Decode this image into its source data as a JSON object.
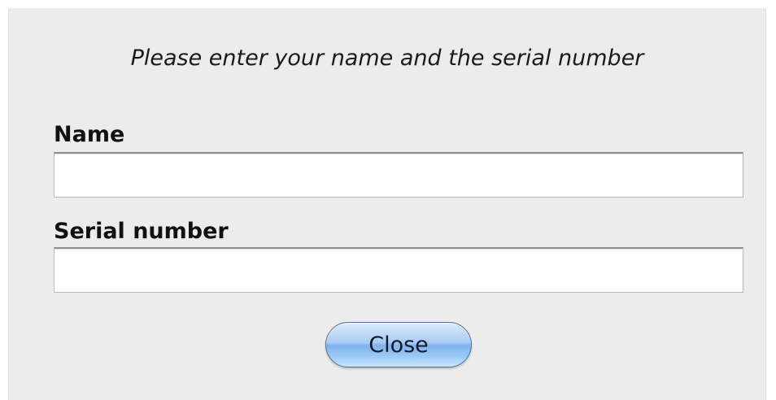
{
  "dialog": {
    "prompt": "Please enter your name and the serial number",
    "fields": {
      "name": {
        "label": "Name",
        "value": "",
        "placeholder": ""
      },
      "serial": {
        "label": "Serial number",
        "value": "",
        "placeholder": ""
      }
    },
    "close_label": "Close",
    "button_color": "#8ebfee"
  }
}
